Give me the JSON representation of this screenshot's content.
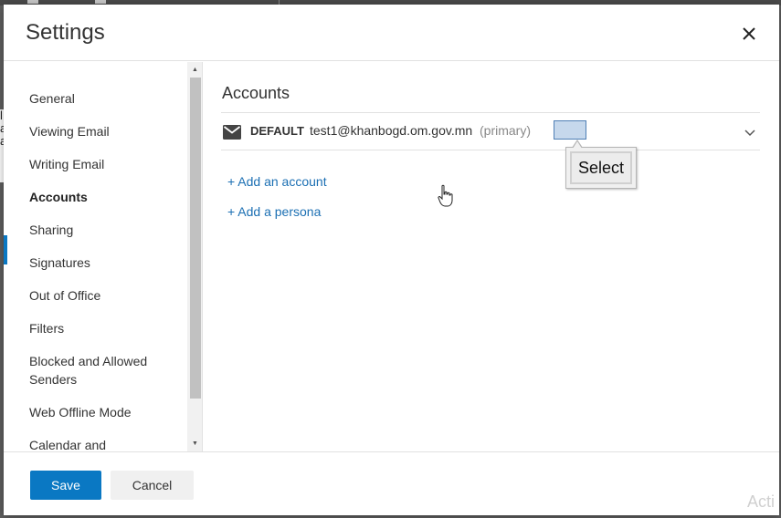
{
  "dialog": {
    "title": "Settings"
  },
  "sidebar": {
    "items": [
      {
        "label": "General"
      },
      {
        "label": "Viewing Email"
      },
      {
        "label": "Writing Email"
      },
      {
        "label": "Accounts",
        "active": true
      },
      {
        "label": "Sharing"
      },
      {
        "label": "Signatures"
      },
      {
        "label": "Out of Office"
      },
      {
        "label": "Filters"
      },
      {
        "label": "Blocked and Allowed Senders"
      },
      {
        "label": "Web Offline Mode"
      },
      {
        "label": "Calendar and"
      }
    ]
  },
  "main": {
    "section_title": "Accounts",
    "account": {
      "badge": "DEFAULT",
      "email": "test1@khanbogd.om.gov.mn",
      "primary_label": "(primary)",
      "icon": "mail-icon"
    },
    "tooltip_label": "Select",
    "add_account_label": "+ Add an account",
    "add_persona_label": "+ Add a persona"
  },
  "footer": {
    "save_label": "Save",
    "cancel_label": "Cancel"
  },
  "backdrop": {
    "peek_text": "l a a",
    "watermark": "Acti"
  },
  "colors": {
    "accent": "#0a78c3",
    "link": "#1b6fb3",
    "select_box": "#c6d8ec"
  }
}
